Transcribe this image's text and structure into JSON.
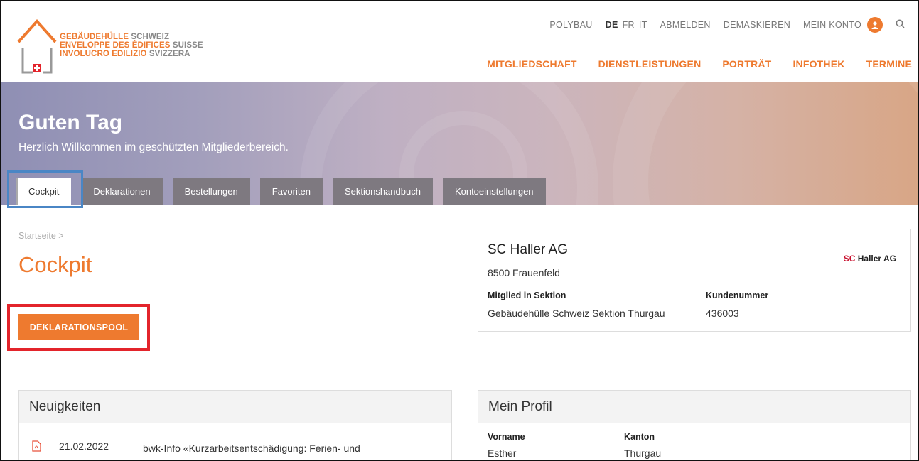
{
  "logo": {
    "line1_bold": "GEBÄUDEHÜLLE",
    "line1_rest": "SCHWEIZ",
    "line2_bold": "ENVELOPPE DES ÉDIFICES",
    "line2_rest": "SUISSE",
    "line3_bold": "INVOLUCRO EDILIZIO",
    "line3_rest": "SVIZZERA"
  },
  "utility_nav": {
    "polybau": "POLYBAU",
    "lang_de": "DE",
    "lang_fr": "FR",
    "lang_it": "IT",
    "logout": "ABMELDEN",
    "unmask": "DEMASKIEREN",
    "account": "MEIN KONTO"
  },
  "main_nav": [
    "MITGLIEDSCHAFT",
    "DIENSTLEISTUNGEN",
    "PORTRÄT",
    "INFOTHEK",
    "TERMINE"
  ],
  "hero": {
    "title": "Guten Tag",
    "subtitle": "Herzlich Willkommen im geschützten Mitgliederbereich."
  },
  "tabs": [
    "Cockpit",
    "Deklarationen",
    "Bestellungen",
    "Favoriten",
    "Sektionshandbuch",
    "Kontoeinstellungen"
  ],
  "active_tab": "Cockpit",
  "breadcrumb": "Startseite >",
  "page_title": "Cockpit",
  "pool_button": "DEKLARATIONSPOOL",
  "company": {
    "name": "SC Haller AG",
    "city": "8500 Frauenfeld",
    "section_label": "Mitglied in Sektion",
    "section_value": "Gebäudehülle Schweiz Sektion Thurgau",
    "customer_label": "Kundenummer",
    "customer_value": "436003",
    "logo_sc": "SC",
    "logo_rest": "Haller AG"
  },
  "news": {
    "title": "Neuigkeiten",
    "items": [
      {
        "date": "21.02.2022",
        "text": "bwk-Info «Kurzarbeitsentschädigung: Ferien- und Feiertagsanteil für Mitarbeitende im Monatslohn»",
        "icon": "pdf-icon"
      }
    ]
  },
  "profile": {
    "title": "Mein Profil",
    "firstname_label": "Vorname",
    "firstname_value": "Esther",
    "canton_label": "Kanton",
    "canton_value": "Thurgau"
  },
  "colors": {
    "accent": "#ee7a2f",
    "tab_bg": "#7e7980",
    "highlight_blue": "#4a86c5",
    "highlight_red": "#e3242b"
  }
}
